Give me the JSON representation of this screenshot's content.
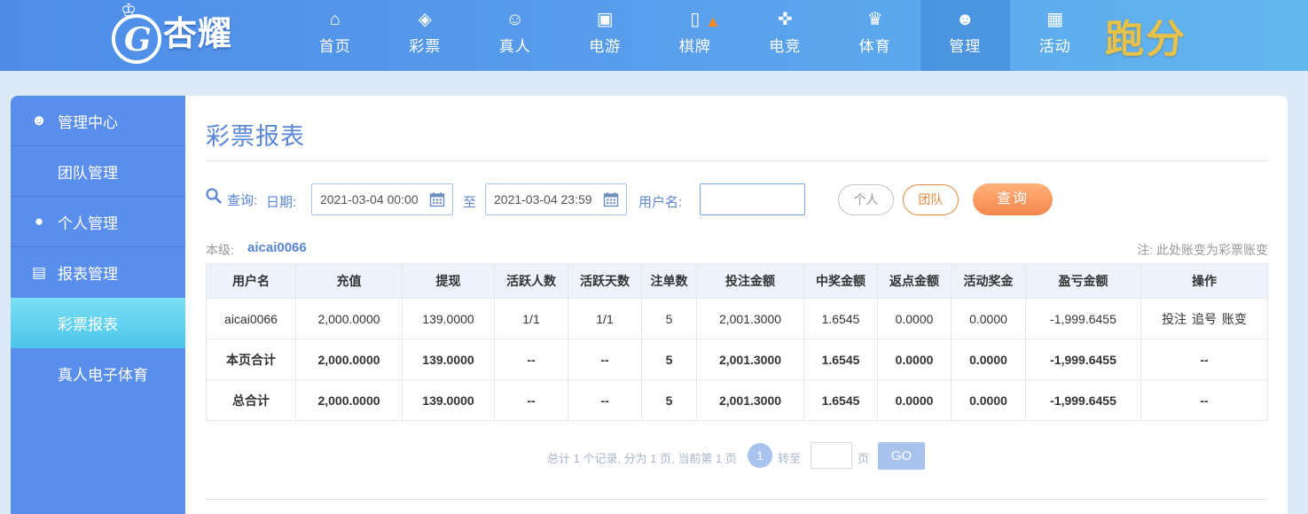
{
  "brand": {
    "logo_text": "杏耀",
    "promo_text": "跑分"
  },
  "nav": [
    {
      "label": "首页",
      "icon": "home-icon",
      "glyph": "⌂"
    },
    {
      "label": "彩票",
      "icon": "lottery-icon",
      "glyph": "◈"
    },
    {
      "label": "真人",
      "icon": "live-dealer-icon",
      "glyph": "☺"
    },
    {
      "label": "电游",
      "icon": "slot-machine-icon",
      "glyph": "▣"
    },
    {
      "label": "棋牌",
      "icon": "cards-icon",
      "glyph": "▯"
    },
    {
      "label": "电竞",
      "icon": "gamepad-icon",
      "glyph": "✜"
    },
    {
      "label": "体育",
      "icon": "trophy-icon",
      "glyph": "♛"
    },
    {
      "label": "管理",
      "icon": "users-icon",
      "glyph": "☻"
    },
    {
      "label": "活动",
      "icon": "gift-icon",
      "glyph": "▦"
    }
  ],
  "sidebar": {
    "items": [
      {
        "label": "管理中心",
        "icon": "users-icon",
        "glyph": "☻"
      },
      {
        "label": "团队管理"
      },
      {
        "label": "个人管理",
        "icon": "user-icon",
        "glyph": "●"
      },
      {
        "label": "报表管理",
        "icon": "report-icon",
        "glyph": "▤"
      },
      {
        "label": "彩票报表"
      },
      {
        "label": "真人电子体育"
      }
    ]
  },
  "page": {
    "title": "彩票报表"
  },
  "filter": {
    "query_label": "查询:",
    "date_label": "日期:",
    "date_start": "2021-03-04 00:00",
    "to_label": "至",
    "date_end": "2021-03-04 23:59",
    "username_label": "用户名:",
    "username_value": "",
    "personal_label": "个人",
    "team_label": "团队",
    "query_button": "查询"
  },
  "level": {
    "label": "本级:",
    "value": "aicai0066"
  },
  "note": "注: 此处账变为彩票账变",
  "table": {
    "headers": [
      "用户名",
      "充值",
      "提现",
      "活跃人数",
      "活跃天数",
      "注单数",
      "投注金额",
      "中奖金额",
      "返点金额",
      "活动奖金",
      "盈亏金额",
      "操作"
    ],
    "row": {
      "username": "aicai0066",
      "recharge": "2,000.0000",
      "withdraw": "139.0000",
      "active_users": "1/1",
      "active_days": "1/1",
      "orders": "5",
      "bet_amount": "2,001.3000",
      "win_amount": "1.6545",
      "rebate": "0.0000",
      "bonus": "0.0000",
      "profit": "-1,999.6455",
      "ops": [
        "投注",
        "追号",
        "账变"
      ]
    },
    "page_total": {
      "label": "本页合计",
      "recharge": "2,000.0000",
      "withdraw": "139.0000",
      "active_users": "--",
      "active_days": "--",
      "orders": "5",
      "bet_amount": "2,001.3000",
      "win_amount": "1.6545",
      "rebate": "0.0000",
      "bonus": "0.0000",
      "profit": "-1,999.6455",
      "ops": "--"
    },
    "grand_total": {
      "label": "总合计",
      "recharge": "2,000.0000",
      "withdraw": "139.0000",
      "active_users": "--",
      "active_days": "--",
      "orders": "5",
      "bet_amount": "2,001.3000",
      "win_amount": "1.6545",
      "rebate": "0.0000",
      "bonus": "0.0000",
      "profit": "-1,999.6455",
      "ops": "--"
    }
  },
  "pager": {
    "summary": "总计 1 个记录, 分为 1 页, 当前第 1 页",
    "current": "1",
    "goto_label": "转至",
    "page_unit": "页",
    "go_button": "GO"
  },
  "colors": {
    "accent": "#5a86d6",
    "sidebar": "#5a8eec",
    "negative": "#e0202a",
    "query_button": "#f5864b"
  }
}
